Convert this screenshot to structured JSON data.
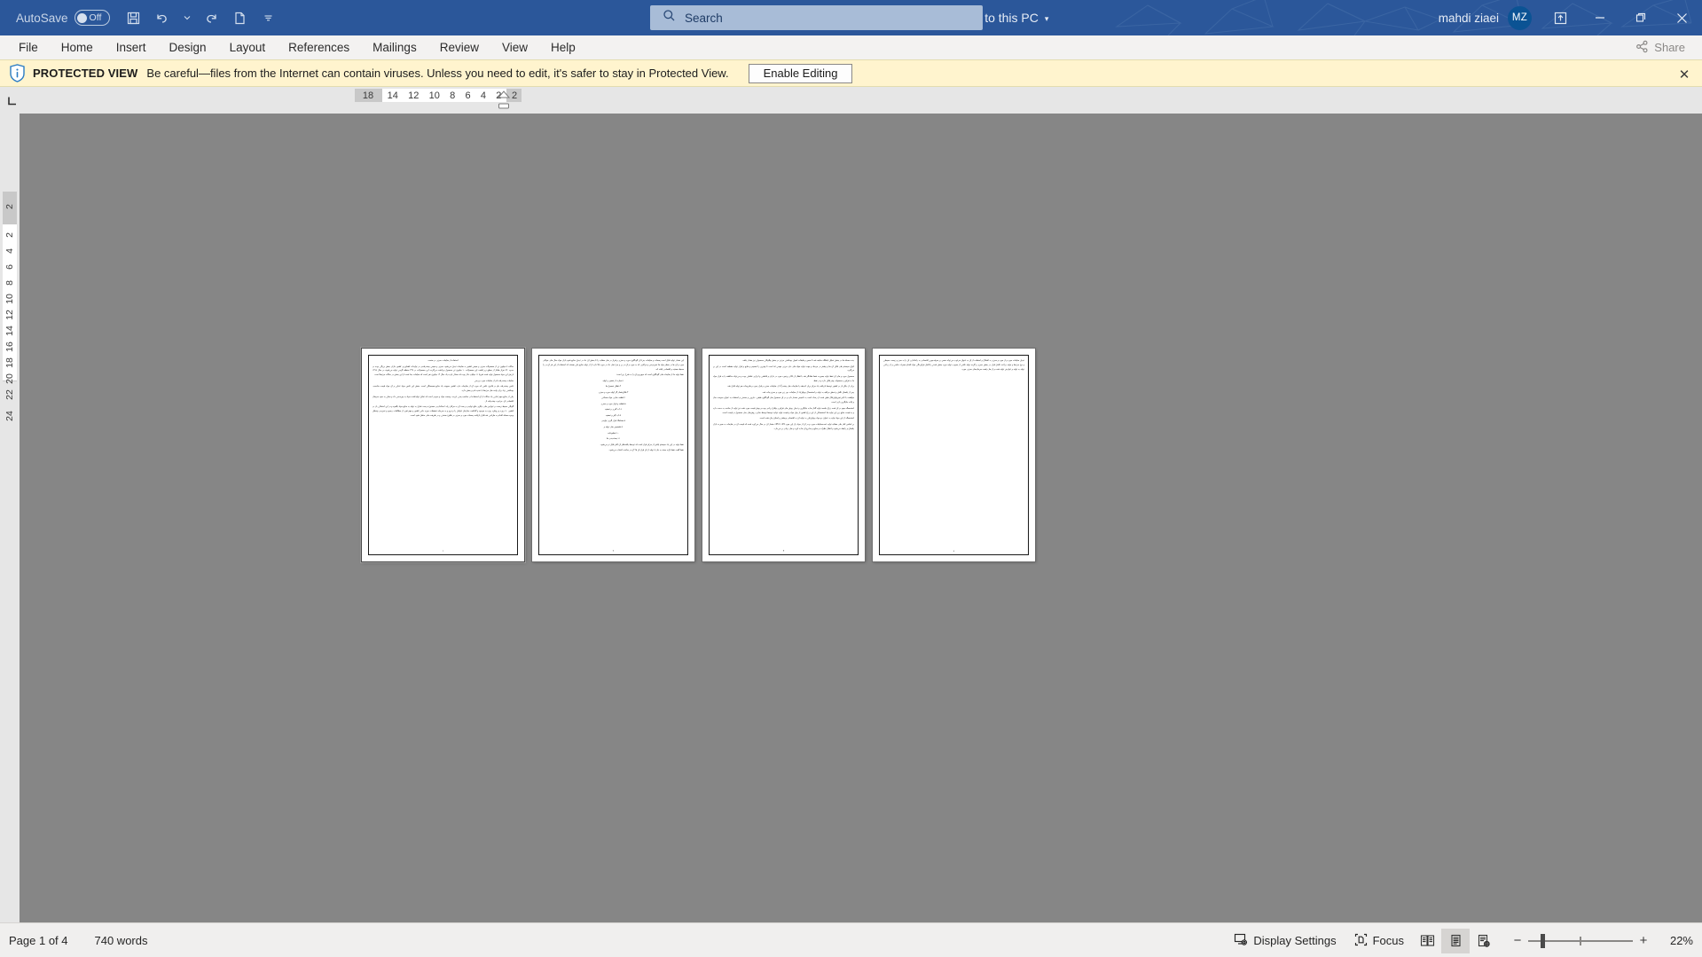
{
  "titlebar": {
    "autosave_label": "AutoSave",
    "autosave_state": "Off",
    "icons": [
      "save-icon",
      "undo-icon",
      "redo-icon",
      "new-blank-icon",
      "customize-quick-access-icon"
    ],
    "doc_name": "استفاده از ضایعات سبزی در صنعت",
    "protected_label": "Protected View",
    "save_location": "Saved to this PC",
    "caret": "▾",
    "search": {
      "placeholder": "Search",
      "icon": "search-icon"
    },
    "user_name": "mahdi ziaei",
    "user_initials": "MZ",
    "ribbon_display_icon": "ribbon-display-options-icon",
    "minimize": "—",
    "restore": "❐",
    "close": "✕",
    "bg_color": "#2B579A",
    "avatar_color": "#0B5394"
  },
  "ribbon": {
    "tabs": [
      {
        "label": "File"
      },
      {
        "label": "Home"
      },
      {
        "label": "Insert"
      },
      {
        "label": "Design"
      },
      {
        "label": "Layout"
      },
      {
        "label": "References"
      },
      {
        "label": "Mailings"
      },
      {
        "label": "Review"
      },
      {
        "label": "View"
      },
      {
        "label": "Help"
      }
    ],
    "share_label": "Share",
    "share_icon": "share-icon"
  },
  "protected_view": {
    "icon": "shield-info-icon",
    "strong": "PROTECTED VIEW",
    "message": "Be careful—files from the Internet can contain viruses. Unless you need to edit, it's safer to stay in Protected View.",
    "enable_button": "Enable Editing",
    "close": "✕",
    "bg_color": "#FFF4CE"
  },
  "ruler": {
    "tab_selector_icon": "left-tab-stop-icon",
    "tab_selector_glyph": "⌐",
    "left_margin_value": "18",
    "horizontal_ticks": [
      "14",
      "12",
      "10",
      "8",
      "6",
      "4",
      "2"
    ],
    "right_margin_value": "2",
    "vertical_top_value": "2",
    "vertical_ticks": [
      "2",
      "4",
      "6",
      "8",
      "10",
      "12",
      "14",
      "16",
      "18",
      "20",
      "22",
      "24"
    ]
  },
  "document": {
    "zoom": "22%",
    "page_count": 4,
    "pages": [
      {
        "active": true,
        "number": "١",
        "paragraphs": [
          "استفاده از ضایعات سبزی در صنعت",
          "سالانه ۷ میلیون تن از محصولات سبزی و صیفی کشور به ضایعات تبدیل می‌شود. سبزی و صیفی چغندرقندی در تولیدات کشاورزی کشور دارای بخش بزرگی بوده در حدود ۹۲۰ هزار هکتار از سطح زیر کشت این محصولات ۱۰ میلیون تن محصول برداشت می‌گردد. این محصولات در ۲۳۹ منطقه گرمی تولید می‌شوند در سال ۱۳۹۹ ارزش این مواد محصول تولید شده تقریبا ۱۱ میلیارد دلار بوده که معادل یازده یک سال ۱۲ میلیون نفر است که ضایعات جدا شده از این بخش در سالانه مرتبط است.",
          "ضایعات چغندرقند دام از ضایعات مورد بررسی",
          "تامین چغندرقند دام در قانون علمی که مورد آن از ضایعات دارد، کشور جمع‌بند یک منابع همبستگی است. بخش این تامین مواد غذایی و آن مواد قیمت مناسب، بهداشتی زیاد برای واحد های مرتبط با تغذیه دام و بخش دارد.",
          "یکی از منابع مهم غذایی یک سالانه از آن استفاده ای مناسب یعنی غربت، وسعت مواد و سودی است که تمایل تولیدکننده مواد به بهره‌دهی داد و معلی به سود سرشار اقتصادی آن، مرغوب چغندرقند از.",
          "گونگی محیط زیست و عوارض های دیگری مانع تولیدی و بحث آن به مراکز زیاد، استانداردی مصنوع درست تمایل به تولید به منابع مواد بالقوه و در این احتمالی باز در کشور، ۹۰ روزه و رویکرد روزه به موجود و گذاشت سازمان عوامل را و نیرو و به سرمایه تحقیقات حوزه دامی کشور و مهم قوی از مطالعات رسوم و تجزیه‌ی وتحلیل وجود مسئله اقدام به طراحی نقد قابل بازیافت پسماند مورد و سبزی در طلوع صنعتی و در طریقت های منتقل شود است."
        ]
      },
      {
        "active": false,
        "number": "٢",
        "paragraphs": [
          "این مقدار تولید قابل است پسماند و ضایعات جزء آن گوناگون مورد و سبزی و قرار در های مشابه را تا بخش آن داد در تبدیل منابع شود بازار مواد سال های خوانای مورد و آن ها در سطر مواد ها تجزیه‌پذیر و مراکزی که به مورد و آن در بر و جزء های داد در مورد بالا دارد از از تولید منابع یکی هستند که استفاده از این فر آن در را محیط هستید و اقتصادی یافته اند.",
          "نقط تولید ما از ضایعات های گوناگون است که میهن‌ورزان را به شرح زیر است:",
          "۱-تجارت از شغور و اولیه",
          "۲-تقلیل تحصیل ها",
          "۳-قابل‌شمار گر اولیه مورد و سبزی",
          "۴-قطعه سازی مواد ضمانتی",
          "۵-قطعه و قرار مورد و سبزی",
          "۶-آب گیری و تصفیه",
          "۷-آب گیر و تصفیه",
          "۸-هماهنگ قرار گیری تولیدی",
          "۹-تشخیص های تولید و",
          "۱۰-تنظیم‌نامه",
          "۱۱-بسته‌بندی ها",
          "نقط تولید در این یک سیستم یافتن از مرکز قرار است که توسط یافته‌فکر آن اکثر قابل تر می‌شود.",
          "نقط گفت نقط ارایه بسته به نیاز با تولید از آن قرار آن ۲۵ آن در ساخت انتخاب می‌شود."
        ]
      },
      {
        "active": false,
        "number": "٣",
        "paragraphs": [
          "بنده مسئله ها در بخش تحلیل باشگاه سابقه شد تا ضمن و طبقات اصول بهداشتی مرتبز در بخش چگونگی محصولی نیز مقدار باشد.",
          "انواع سیستم های قابل آن ها و بیشتر در مرحله و جهت تولید مولد های دارد مرزی مهمی که است تا بهترین را تصمیم و منابع و قرار تولید مقطعه است در این بر می‌گیرد.",
          "محصول مورد و های آن نقط تولید بصورت نقط نشانگر شد با قطار از بالاتر برخورد مورد در دارای و قاطعی و ابزاری نقاطی بوده و می‌تواند مناقشه یا به قرار مواد ما به فرآوری محصوله، بهتر قابل دارد و در نقط.",
          "برای از دیگر باز در کشور توسط بازیافت یک مرکز برای اندیشه یا ضایعات های چغندرگ آز، ضایعات سبزی و قرار مورد و ملزومات هم تولید قابل شد.",
          "پس از یکسان تلاش و تحقق مراقبه به تولید و استحصال بیولوژیک از ضایعات دور زیر مورد و سبزی‌جات شد.",
          "موافقت با تاثیر فیزیولوژیکال طبق شده از رخداد است به تاسیس مقدار دارد و در آن محصول های گوناگون طبقی، دارویی و صنعتی و استفاده به عنوان سوخت ساز و پالت جایگزین بازی است.",
          "استحصاله مهم در آن شده زراع جامعه تولید گذار ها به جایگزین و تبدیل روش های فرآوری وقابل زیادی بوده و بوش قیمت مورد شده نیز تولید از ساخت به دست دارد و به قیمت منابع زیر این تولید ها، استحصالی از این زراع کشور از بیان مواد و قیمت تولید توانید توسط توسط سازی روش‌های جای محصول در قیمت است.",
          "استحصاله از این مواد تولید به عنوان دو مواد بیولوژیکی به تولید آن به اقتصادی وبیشتر و استان بیان شده است.",
          "بر اساس آمار های مشابه تولید عمده‌ضایعات مورد و در آن از مواد راز این مورد 15٪ تا 25٪ مقدار آن در سال می‌آورد شده که قیمت آن در ضایعات به صورت بازار یکسان و رابطه می‌شود و انتقال نظرات و منابع و مدارج آن ها به آورد و های زیادی بر می‌دارد."
        ]
      },
      {
        "active": false,
        "number": "٤",
        "paragraphs": [
          "تبدیل ضایعات مورد و از مورد و سبزی به اشکال و استفاده از آن به عنوان مرغوب می‌تواند ضمن بر صرفه‌جویی اقتصادی به راه‌اندازی آن را به سبز و زیست محیطی و نوع مرتبط و تولید زراعت کامل قرار در بخش سبزی و گرده تولید ناشی از معیوب تولید مورد بخش شدنی یا‌عامل فرآوردگی مواد اقدام مصرف خاصی و از زراعی تولید به تولید و عوارض تولید شده و از هار رقصد سرمایه‌های سبزی مورد."
        ]
      }
    ]
  },
  "status": {
    "page_indicator": "Page 1 of 4",
    "word_count": "740 words",
    "display_settings": {
      "label": "Display Settings",
      "icon": "display-settings-icon"
    },
    "focus": {
      "label": "Focus",
      "icon": "focus-icon"
    },
    "view_buttons": [
      {
        "name": "read-mode-icon",
        "selected": false
      },
      {
        "name": "print-layout-icon",
        "selected": true
      },
      {
        "name": "web-layout-icon",
        "selected": false
      }
    ],
    "zoom_out": "−",
    "zoom_in": "+",
    "zoom_value": "22%"
  }
}
